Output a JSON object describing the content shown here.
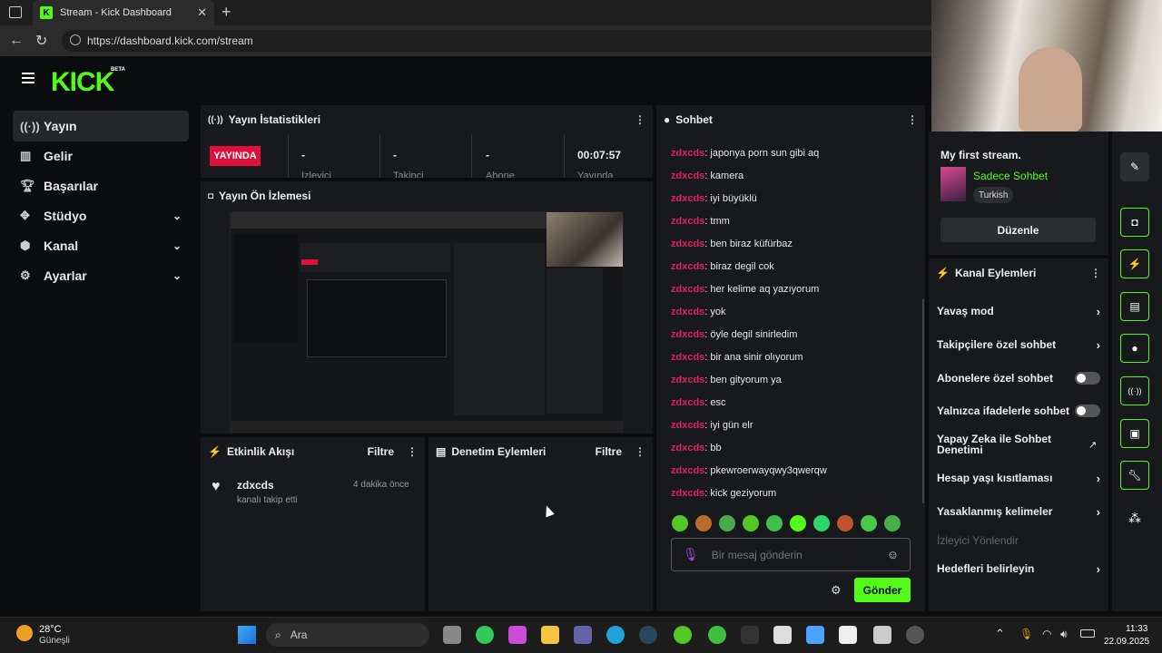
{
  "browser": {
    "tab_title": "Stream - Kick Dashboard",
    "url": "https://dashboard.kick.com/stream"
  },
  "brand": {
    "logo": "KICK",
    "beta": "BETA",
    "accent": "#53fc18"
  },
  "nav": {
    "items": [
      {
        "label": "Yayın",
        "icon": "broadcast-icon"
      },
      {
        "label": "Gelir",
        "icon": "revenue-icon"
      },
      {
        "label": "Başarılar",
        "icon": "trophy-icon"
      },
      {
        "label": "Stüdyo",
        "icon": "studio-icon"
      },
      {
        "label": "Kanal",
        "icon": "channel-icon"
      },
      {
        "label": "Ayarlar",
        "icon": "gear-icon"
      }
    ]
  },
  "stats": {
    "title": "Yayın İstatistikleri",
    "live_badge": "YAYINDA",
    "viewers": "-",
    "viewers_label": "İzleyici",
    "followers": "-",
    "followers_label": "Takipçi",
    "subs": "-",
    "subs_label": "Abone",
    "duration": "00:07:57",
    "duration_label": "Yayında"
  },
  "preview": {
    "title": "Yayın Ön İzlemesi"
  },
  "activity": {
    "title": "Etkinlik Akışı",
    "filter": "Filtre",
    "event_user": "zdxcds",
    "event_time": "4 dakika önce",
    "event_text": "kanalı takip etti"
  },
  "moderation": {
    "title": "Denetim Eylemleri",
    "filter": "Filtre"
  },
  "chat": {
    "title": "Sohbet",
    "messages": [
      {
        "user": "zdxcds",
        "text": "japonya porn sun gibi aq"
      },
      {
        "user": "zdxcds",
        "text": "kamera"
      },
      {
        "user": "zdxcds",
        "text": "iyi büyüklü"
      },
      {
        "user": "zdxcds",
        "text": "tmm"
      },
      {
        "user": "zdxcds",
        "text": "ben biraz küfürbaz"
      },
      {
        "user": "zdxcds",
        "text": "biraz degil cok"
      },
      {
        "user": "zdxcds",
        "text": "her kelime aq yazıyorum"
      },
      {
        "user": "zdxcds",
        "text": "yok"
      },
      {
        "user": "zdxcds",
        "text": "öyle degil sinirledim"
      },
      {
        "user": "zdxcds",
        "text": "bir ana sinir olıyorum"
      },
      {
        "user": "zdxcds",
        "text": "ben gityorum ya"
      },
      {
        "user": "zdxcds",
        "text": "esc"
      },
      {
        "user": "zdxcds",
        "text": "iyi gün elr"
      },
      {
        "user": "zdxcds",
        "text": "bb"
      },
      {
        "user": "zdxcds",
        "text": "pkewroerwayqwy3qwerqw"
      },
      {
        "user": "zdxcds",
        "text": "kick geziyorum"
      }
    ],
    "placeholder": "Bir mesaj gönderin",
    "send": "Gönder"
  },
  "stream_info": {
    "title": "My first stream.",
    "category": "Sadece Sohbet",
    "language": "Turkish",
    "edit": "Düzenle"
  },
  "channel_actions": {
    "title": "Kanal Eylemleri",
    "items": [
      {
        "label": "Yavaş mod",
        "kind": "arrow"
      },
      {
        "label": "Takipçilere özel sohbet",
        "kind": "arrow"
      },
      {
        "label": "Abonelere özel sohbet",
        "kind": "toggle"
      },
      {
        "label": "Yalnızca ifadelerle sohbet",
        "kind": "toggle"
      },
      {
        "label": "Yapay Zeka ile Sohbet Denetimi",
        "kind": "external"
      },
      {
        "label": "Hesap yaşı kısıtlaması",
        "kind": "arrow"
      },
      {
        "label": "Yasaklanmış kelimeler",
        "kind": "arrow"
      },
      {
        "label": "İzleyici Yönlendir",
        "kind": "disabled"
      },
      {
        "label": "Hedefleri belirleyin",
        "kind": "arrow"
      }
    ]
  },
  "taskbar": {
    "weather_temp": "28°C",
    "weather_text": "Güneşli",
    "search": "Ara",
    "time": "11:33",
    "date": "22.09.2025"
  }
}
